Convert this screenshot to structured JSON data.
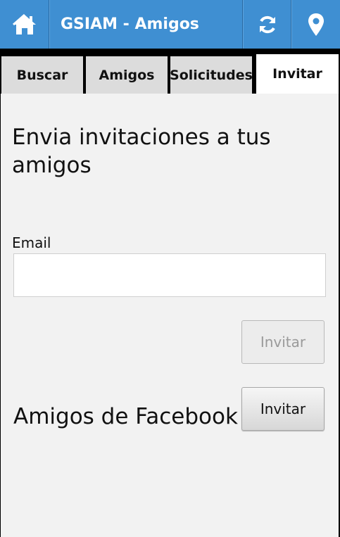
{
  "header": {
    "title": "GSIAM - Amigos",
    "icons": [
      "home-icon",
      "refresh-icon",
      "location-pin-icon"
    ],
    "color": "#3f8fd2"
  },
  "tabs": [
    {
      "label": "Buscar",
      "active": false
    },
    {
      "label": "Amigos",
      "active": false
    },
    {
      "label": "Solicitudes",
      "active": false
    },
    {
      "label": "Invitar",
      "active": true
    }
  ],
  "invite": {
    "heading": "Envia invitaciones a tus amigos",
    "email_label": "Email",
    "email_value": "",
    "email_button": "Invitar",
    "facebook_heading": "Amigos de Facebook",
    "facebook_button": "Invitar"
  }
}
